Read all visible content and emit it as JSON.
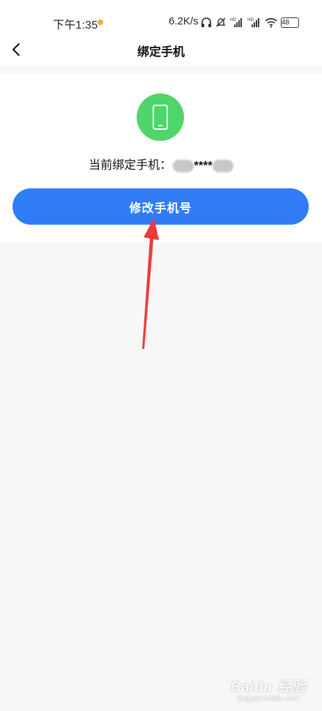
{
  "status_bar": {
    "time": "下午1:35",
    "network_speed": "6.2K/s",
    "battery": "48",
    "icons": [
      "headphones-icon",
      "mute-icon",
      "hd-signal-icon",
      "hd-signal-icon",
      "wifi-icon",
      "battery-icon"
    ],
    "notification_dot_color": "#f7a93a"
  },
  "header": {
    "title": "绑定手机"
  },
  "phone_card": {
    "icon": "phone-icon",
    "icon_bg_color": "#4fd66a",
    "current_label": "当前绑定手机：",
    "masked_number": "****",
    "button_label": "修改手机号",
    "button_color": "#2f7cf6"
  },
  "annotation": {
    "arrow_color": "#f03a3a"
  },
  "watermark": {
    "logo": "Baidu 经验",
    "url": "jingyan.baidu.com"
  }
}
